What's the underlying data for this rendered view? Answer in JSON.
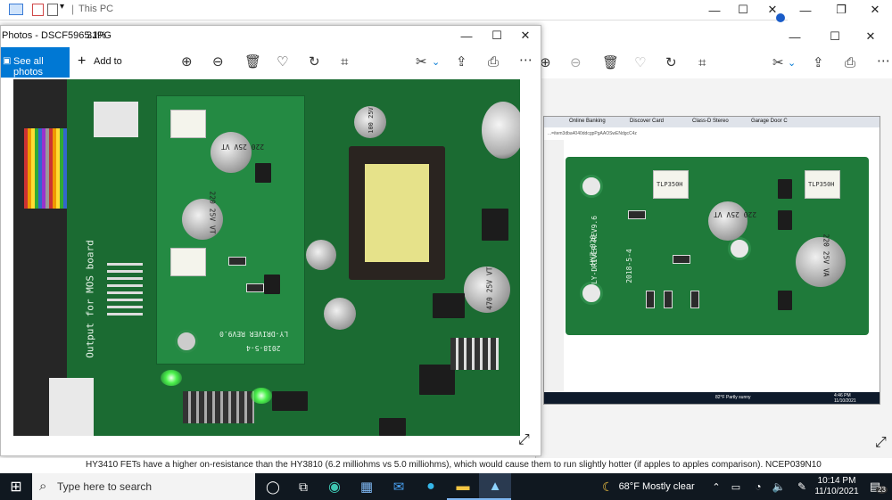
{
  "bg_explorer": {
    "title": "This PC"
  },
  "fg_window": {
    "title": "Photos - DSCF5965.JPG",
    "zoom": "31%",
    "see_all_label": "See all photos",
    "add_to_label": "Add to",
    "board_label_vertical": "Output for MOS board",
    "board_rev": "LY-DRIVER REV9.0",
    "board_date": "2018-5-4",
    "cap_labels": [
      "220 25V VT",
      "220 25V VT",
      "470 25V VT",
      "100 25V"
    ]
  },
  "bg_photos": {
    "browser_tabs": [
      "Online Banking",
      "Discover Card",
      "Class-D Stereo",
      "Garage Door C"
    ],
    "address": "...=item3dba4040ddcgpPgAAOSwENdgcC4z",
    "board_rev": "LY-DRIVER REV9.6",
    "board_code": "HYZ-020",
    "board_date": "2018-5-4",
    "cap_labels": [
      "220 25V VT",
      "220 25V VA"
    ],
    "opto_label": "TLP350H",
    "inner_taskbar": {
      "weather": "82°F Partly sunny",
      "time": "4:46 PM",
      "date": "11/10/2021"
    }
  },
  "message_text": "HY3410 FETs have a higher on-resistance than the HY3810 (6.2 milliohms vs 5.0 milliohms), which would cause them to run slightly hotter (if apples to apples comparison). NCEP039N10",
  "taskbar": {
    "search_placeholder": "Type here to search",
    "weather": "68°F  Mostly clear",
    "time": "10:14 PM",
    "date": "11/10/2021",
    "notification_count": "23"
  },
  "colors": {
    "accent": "#0078d4",
    "pcb": "#1f7a3a",
    "taskbar": "#101820"
  }
}
